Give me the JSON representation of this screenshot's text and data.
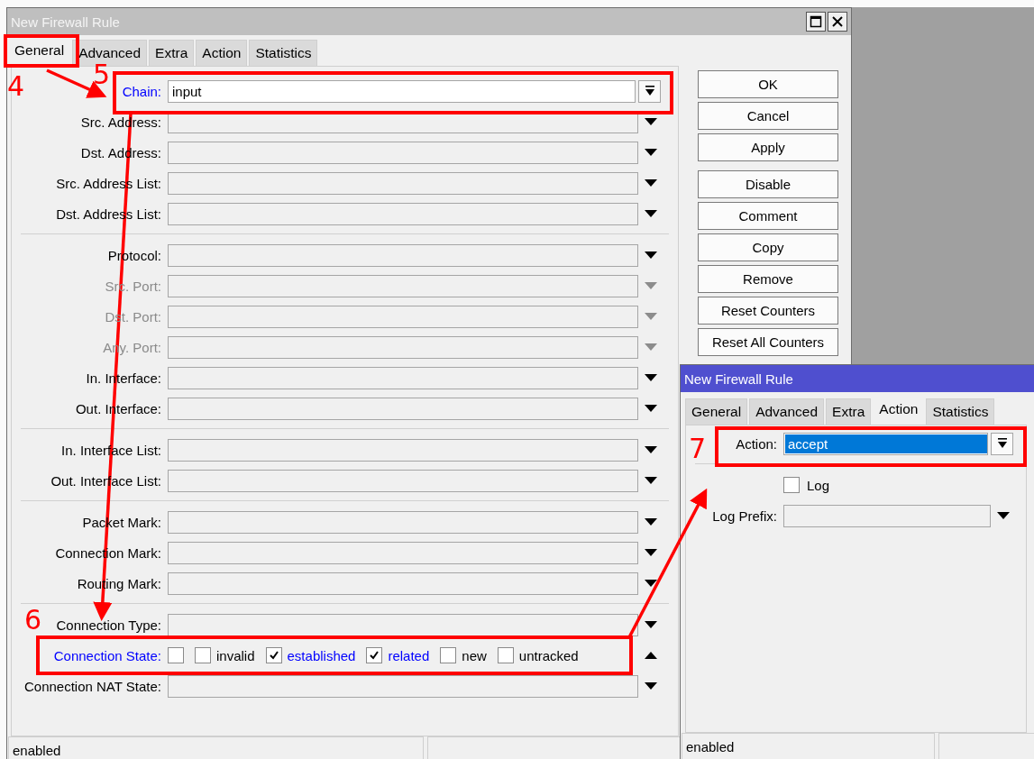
{
  "main_window": {
    "title": "New Firewall Rule",
    "focused": false,
    "tabs": [
      {
        "label": "General",
        "selected": true
      },
      {
        "label": "Advanced",
        "selected": false
      },
      {
        "label": "Extra",
        "selected": false
      },
      {
        "label": "Action",
        "selected": false
      },
      {
        "label": "Statistics",
        "selected": false
      }
    ],
    "groups": [
      [
        {
          "label": "Chain:",
          "kind": "select",
          "set": true,
          "disabled": false,
          "value": "input",
          "value_selected": false
        },
        {
          "label": "Src. Address:",
          "kind": "dropdown",
          "set": false,
          "disabled": false
        },
        {
          "label": "Dst. Address:",
          "kind": "dropdown",
          "set": false,
          "disabled": false
        },
        {
          "label": "Src. Address List:",
          "kind": "dropdown",
          "set": false,
          "disabled": false
        },
        {
          "label": "Dst. Address List:",
          "kind": "dropdown",
          "set": false,
          "disabled": false
        }
      ],
      [
        {
          "label": "Protocol:",
          "kind": "dropdown",
          "set": false,
          "disabled": false
        },
        {
          "label": "Src. Port:",
          "kind": "dropdown",
          "set": false,
          "disabled": true
        },
        {
          "label": "Dst. Port:",
          "kind": "dropdown",
          "set": false,
          "disabled": true
        },
        {
          "label": "Any. Port:",
          "kind": "dropdown",
          "set": false,
          "disabled": true
        },
        {
          "label": "In. Interface:",
          "kind": "dropdown",
          "set": false,
          "disabled": false
        },
        {
          "label": "Out. Interface:",
          "kind": "dropdown",
          "set": false,
          "disabled": false
        }
      ],
      [
        {
          "label": "In. Interface List:",
          "kind": "dropdown",
          "set": false,
          "disabled": false
        },
        {
          "label": "Out. Interface List:",
          "kind": "dropdown",
          "set": false,
          "disabled": false
        }
      ],
      [
        {
          "label": "Packet Mark:",
          "kind": "dropdown",
          "set": false,
          "disabled": false
        },
        {
          "label": "Connection Mark:",
          "kind": "dropdown",
          "set": false,
          "disabled": false
        },
        {
          "label": "Routing Mark:",
          "kind": "dropdown",
          "set": false,
          "disabled": false
        }
      ],
      [
        {
          "label": "Connection Type:",
          "kind": "dropdown",
          "set": false,
          "disabled": false
        },
        {
          "label": "Connection State:",
          "kind": "checkboxes",
          "set": true,
          "disabled": false,
          "negated": false,
          "options": [
            {
              "label": "invalid",
              "checked": false
            },
            {
              "label": "established",
              "checked": true
            },
            {
              "label": "related",
              "checked": true
            },
            {
              "label": "new",
              "checked": false
            },
            {
              "label": "untracked",
              "checked": false
            }
          ]
        },
        {
          "label": "Connection NAT State:",
          "kind": "dropdown",
          "set": false,
          "disabled": false
        }
      ]
    ],
    "button_groups": [
      [
        "OK",
        "Cancel",
        "Apply"
      ],
      [
        "Disable",
        "Comment",
        "Copy",
        "Remove",
        "Reset Counters",
        "Reset All Counters"
      ]
    ],
    "status_bar": [
      "enabled"
    ]
  },
  "action_window": {
    "title": "New Firewall Rule",
    "focused": true,
    "tabs": [
      {
        "label": "General",
        "selected": false
      },
      {
        "label": "Advanced",
        "selected": false
      },
      {
        "label": "Extra",
        "selected": false
      },
      {
        "label": "Action",
        "selected": true
      },
      {
        "label": "Statistics",
        "selected": false
      }
    ],
    "groups": [
      [
        {
          "label": "Action:",
          "kind": "select",
          "value": "accept",
          "value_selected": true
        }
      ],
      [
        {
          "label": "Log",
          "kind": "checkbox",
          "checked": false
        },
        {
          "label": "Log Prefix:",
          "kind": "dropdown"
        }
      ]
    ],
    "status_bar": [
      "enabled"
    ]
  },
  "annotations": {
    "numbers": [
      "4",
      "5",
      "6",
      "7"
    ]
  }
}
